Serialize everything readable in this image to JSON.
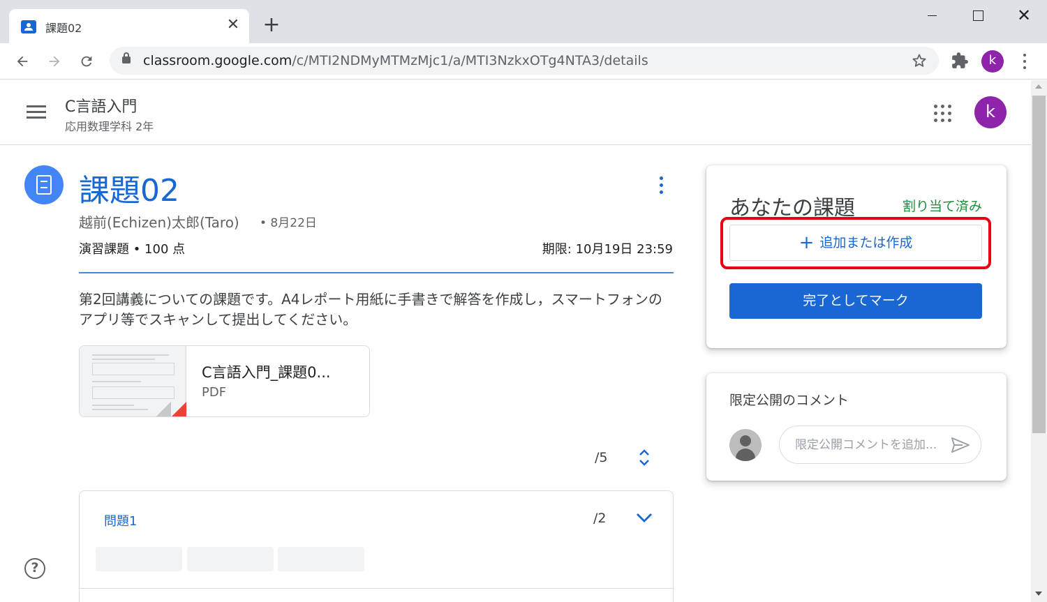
{
  "browser": {
    "tab_title": "課題02",
    "tab_close": "✕",
    "new_tab": "+",
    "win_close": "✕",
    "url_host": "classroom.google.com",
    "url_path": "/c/MTI2NDMyMTMzMjc1/a/MTI3NzkxOTg4NTA3/details",
    "profile_initial": "k",
    "icons": [
      "back-icon",
      "forward-icon",
      "reload-icon",
      "lock-icon",
      "star-icon",
      "extensions-icon",
      "chrome-menu-icon"
    ]
  },
  "header": {
    "class_name": "C言語入門",
    "class_section": "応用数理学科 2年",
    "avatar_initial": "k"
  },
  "assignment": {
    "title": "課題02",
    "author": "越前(Echizen)太郎(Taro)",
    "date": "• 8月22日",
    "points": "演習課題 • 100 点",
    "due": "期限: 10月19日 23:59",
    "description": "第2回講義についての課題です。A4レポート用紙に手書きで解答を作成し，スマートフォンのアプリ等でスキャンして提出してください。",
    "attachment": {
      "name": "C言語入門_課題0...",
      "type": "PDF"
    },
    "total_points": "/5",
    "question": {
      "title": "問題1",
      "points": "/2"
    }
  },
  "your_work": {
    "title": "あなたの課題",
    "status": "割り当て済み",
    "add_button": "追加または作成",
    "add_plus": "+",
    "mark_done_button": "完了としてマーク"
  },
  "private_comments": {
    "title": "限定公開のコメント",
    "placeholder": "限定公開コメントを追加..."
  },
  "help_label": "?",
  "colors": {
    "accent": "#1967d2",
    "status_green": "#1e8e3e",
    "highlight_red": "#e60012",
    "avatar_purple": "#8e24aa"
  }
}
